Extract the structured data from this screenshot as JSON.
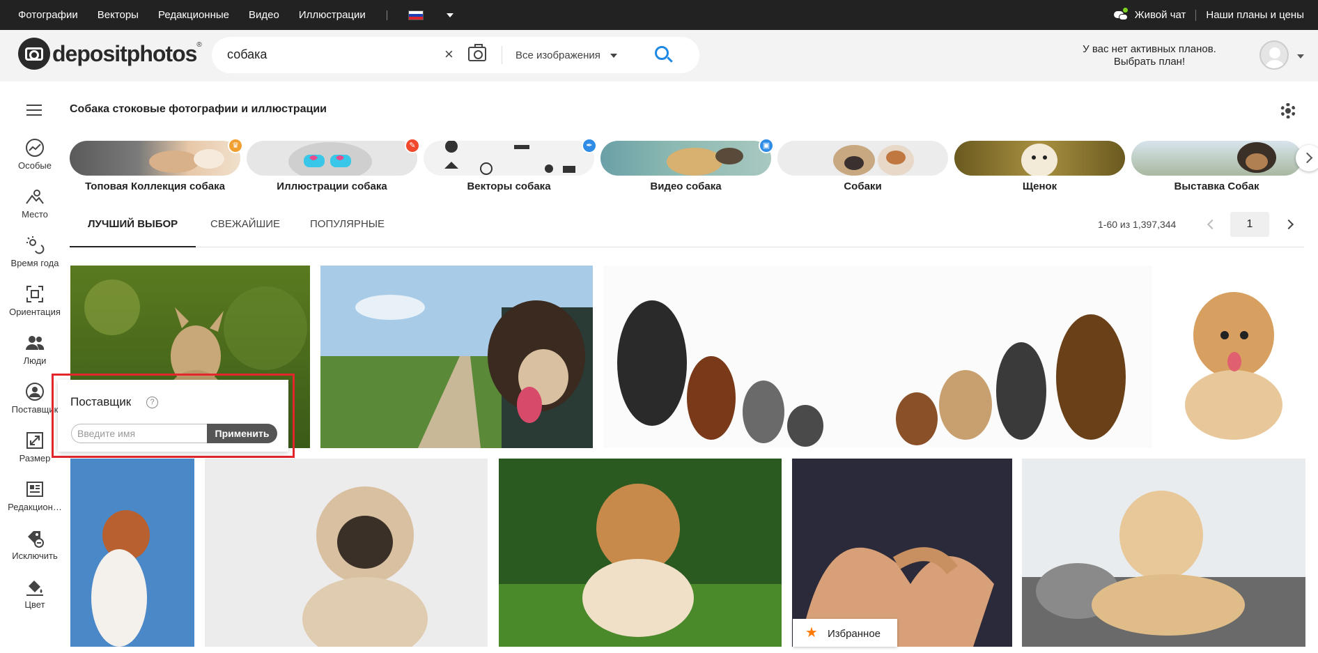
{
  "topnav": {
    "items": [
      "Фотографии",
      "Векторы",
      "Редакционные",
      "Видео",
      "Иллюстрации"
    ],
    "live_chat": "Живой чат",
    "plans": "Наши планы и цены",
    "flag_colors": [
      "#ffffff",
      "#1c3fb6",
      "#e0242b"
    ]
  },
  "header": {
    "logo_text": "depositphotos",
    "logo_mark": "®",
    "search_query": "собака",
    "search_type": "Все изображения",
    "plan_line1": "У вас нет активных планов.",
    "plan_line2": "Выбрать план!"
  },
  "sidebar": {
    "items": [
      {
        "label": "Особые",
        "icon": "trending-icon"
      },
      {
        "label": "Место",
        "icon": "place-icon"
      },
      {
        "label": "Время года",
        "icon": "season-icon"
      },
      {
        "label": "Ориентация",
        "icon": "orientation-icon"
      },
      {
        "label": "Люди",
        "icon": "people-icon"
      },
      {
        "label": "Поставщик",
        "icon": "contributor-icon"
      },
      {
        "label": "Размер",
        "icon": "size-icon"
      },
      {
        "label": "Редакцион…",
        "icon": "editorial-icon"
      },
      {
        "label": "Исключить",
        "icon": "exclude-icon"
      },
      {
        "label": "Цвет",
        "icon": "color-icon"
      }
    ]
  },
  "page_title": "Собака стоковые фотографии и иллюстрации",
  "categories": [
    {
      "label": "Топовая Коллекция собака",
      "badge_color": "#f0a030",
      "badge": "♛"
    },
    {
      "label": "Иллюстрации собака",
      "badge_color": "#f0492c",
      "badge": "✎"
    },
    {
      "label": "Векторы собака",
      "badge_color": "#2e8ce6",
      "badge": "✒"
    },
    {
      "label": "Видео собака",
      "badge_color": "#2e8ce6",
      "badge": "▣"
    },
    {
      "label": "Собаки",
      "badge_color": "",
      "badge": ""
    },
    {
      "label": "Щенок",
      "badge_color": "",
      "badge": ""
    },
    {
      "label": "Выставка Собак",
      "badge_color": "",
      "badge": ""
    }
  ],
  "tabs": [
    "ЛУЧШИЙ ВЫБОР",
    "СВЕЖАЙШИЕ",
    "ПОПУЛЯРНЫЕ"
  ],
  "pager": {
    "range": "1-60 из 1,397,344",
    "page": "1"
  },
  "popover": {
    "title": "Поставщик",
    "help": "?",
    "placeholder": "Введите имя",
    "button": "Применить"
  },
  "favorite_label": "Избранное"
}
